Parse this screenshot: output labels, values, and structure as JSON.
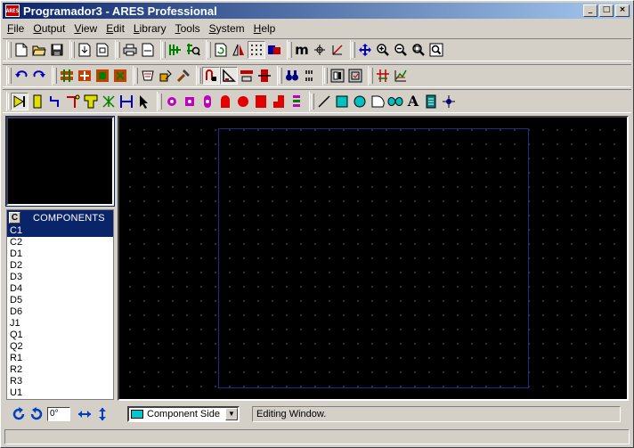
{
  "window": {
    "title": "Programador3 - ARES Professional",
    "app_icon_text": "ARES",
    "buttons": {
      "minimize": "_",
      "maximize": "□",
      "close": "×"
    }
  },
  "menu": {
    "items": [
      {
        "label": "File",
        "accel": "F"
      },
      {
        "label": "Output",
        "accel": "O"
      },
      {
        "label": "View",
        "accel": "V"
      },
      {
        "label": "Edit",
        "accel": "E"
      },
      {
        "label": "Library",
        "accel": "L"
      },
      {
        "label": "Tools",
        "accel": "T"
      },
      {
        "label": "System",
        "accel": "S"
      },
      {
        "label": "Help",
        "accel": "H"
      }
    ]
  },
  "toolbar": {
    "icons": {
      "new": "new-file-icon",
      "open": "open-folder-icon",
      "save": "save-icon",
      "undo": "undo-icon",
      "redo": "redo-icon",
      "zoom_in": "zoom-in-icon",
      "zoom_out": "zoom-out-icon",
      "text": "A",
      "metric": "m"
    }
  },
  "overview": {
    "label": "overview"
  },
  "components": {
    "mode_label": "C",
    "title": "COMPONENTS",
    "items": [
      "C1",
      "C2",
      "D1",
      "D2",
      "D3",
      "D4",
      "D5",
      "D6",
      "J1",
      "Q1",
      "Q2",
      "R1",
      "R2",
      "R3",
      "U1"
    ],
    "selected_index": 0
  },
  "bottom": {
    "rotation_value": "0°",
    "layer": "Component Side",
    "layer_color": "#00c8d0",
    "status_message": "Editing Window."
  },
  "colors": {
    "title_gradient_start": "#0a246a",
    "canvas_background": "#000000",
    "board_outline": "#1c2c8c",
    "selection": "#0a246a"
  }
}
